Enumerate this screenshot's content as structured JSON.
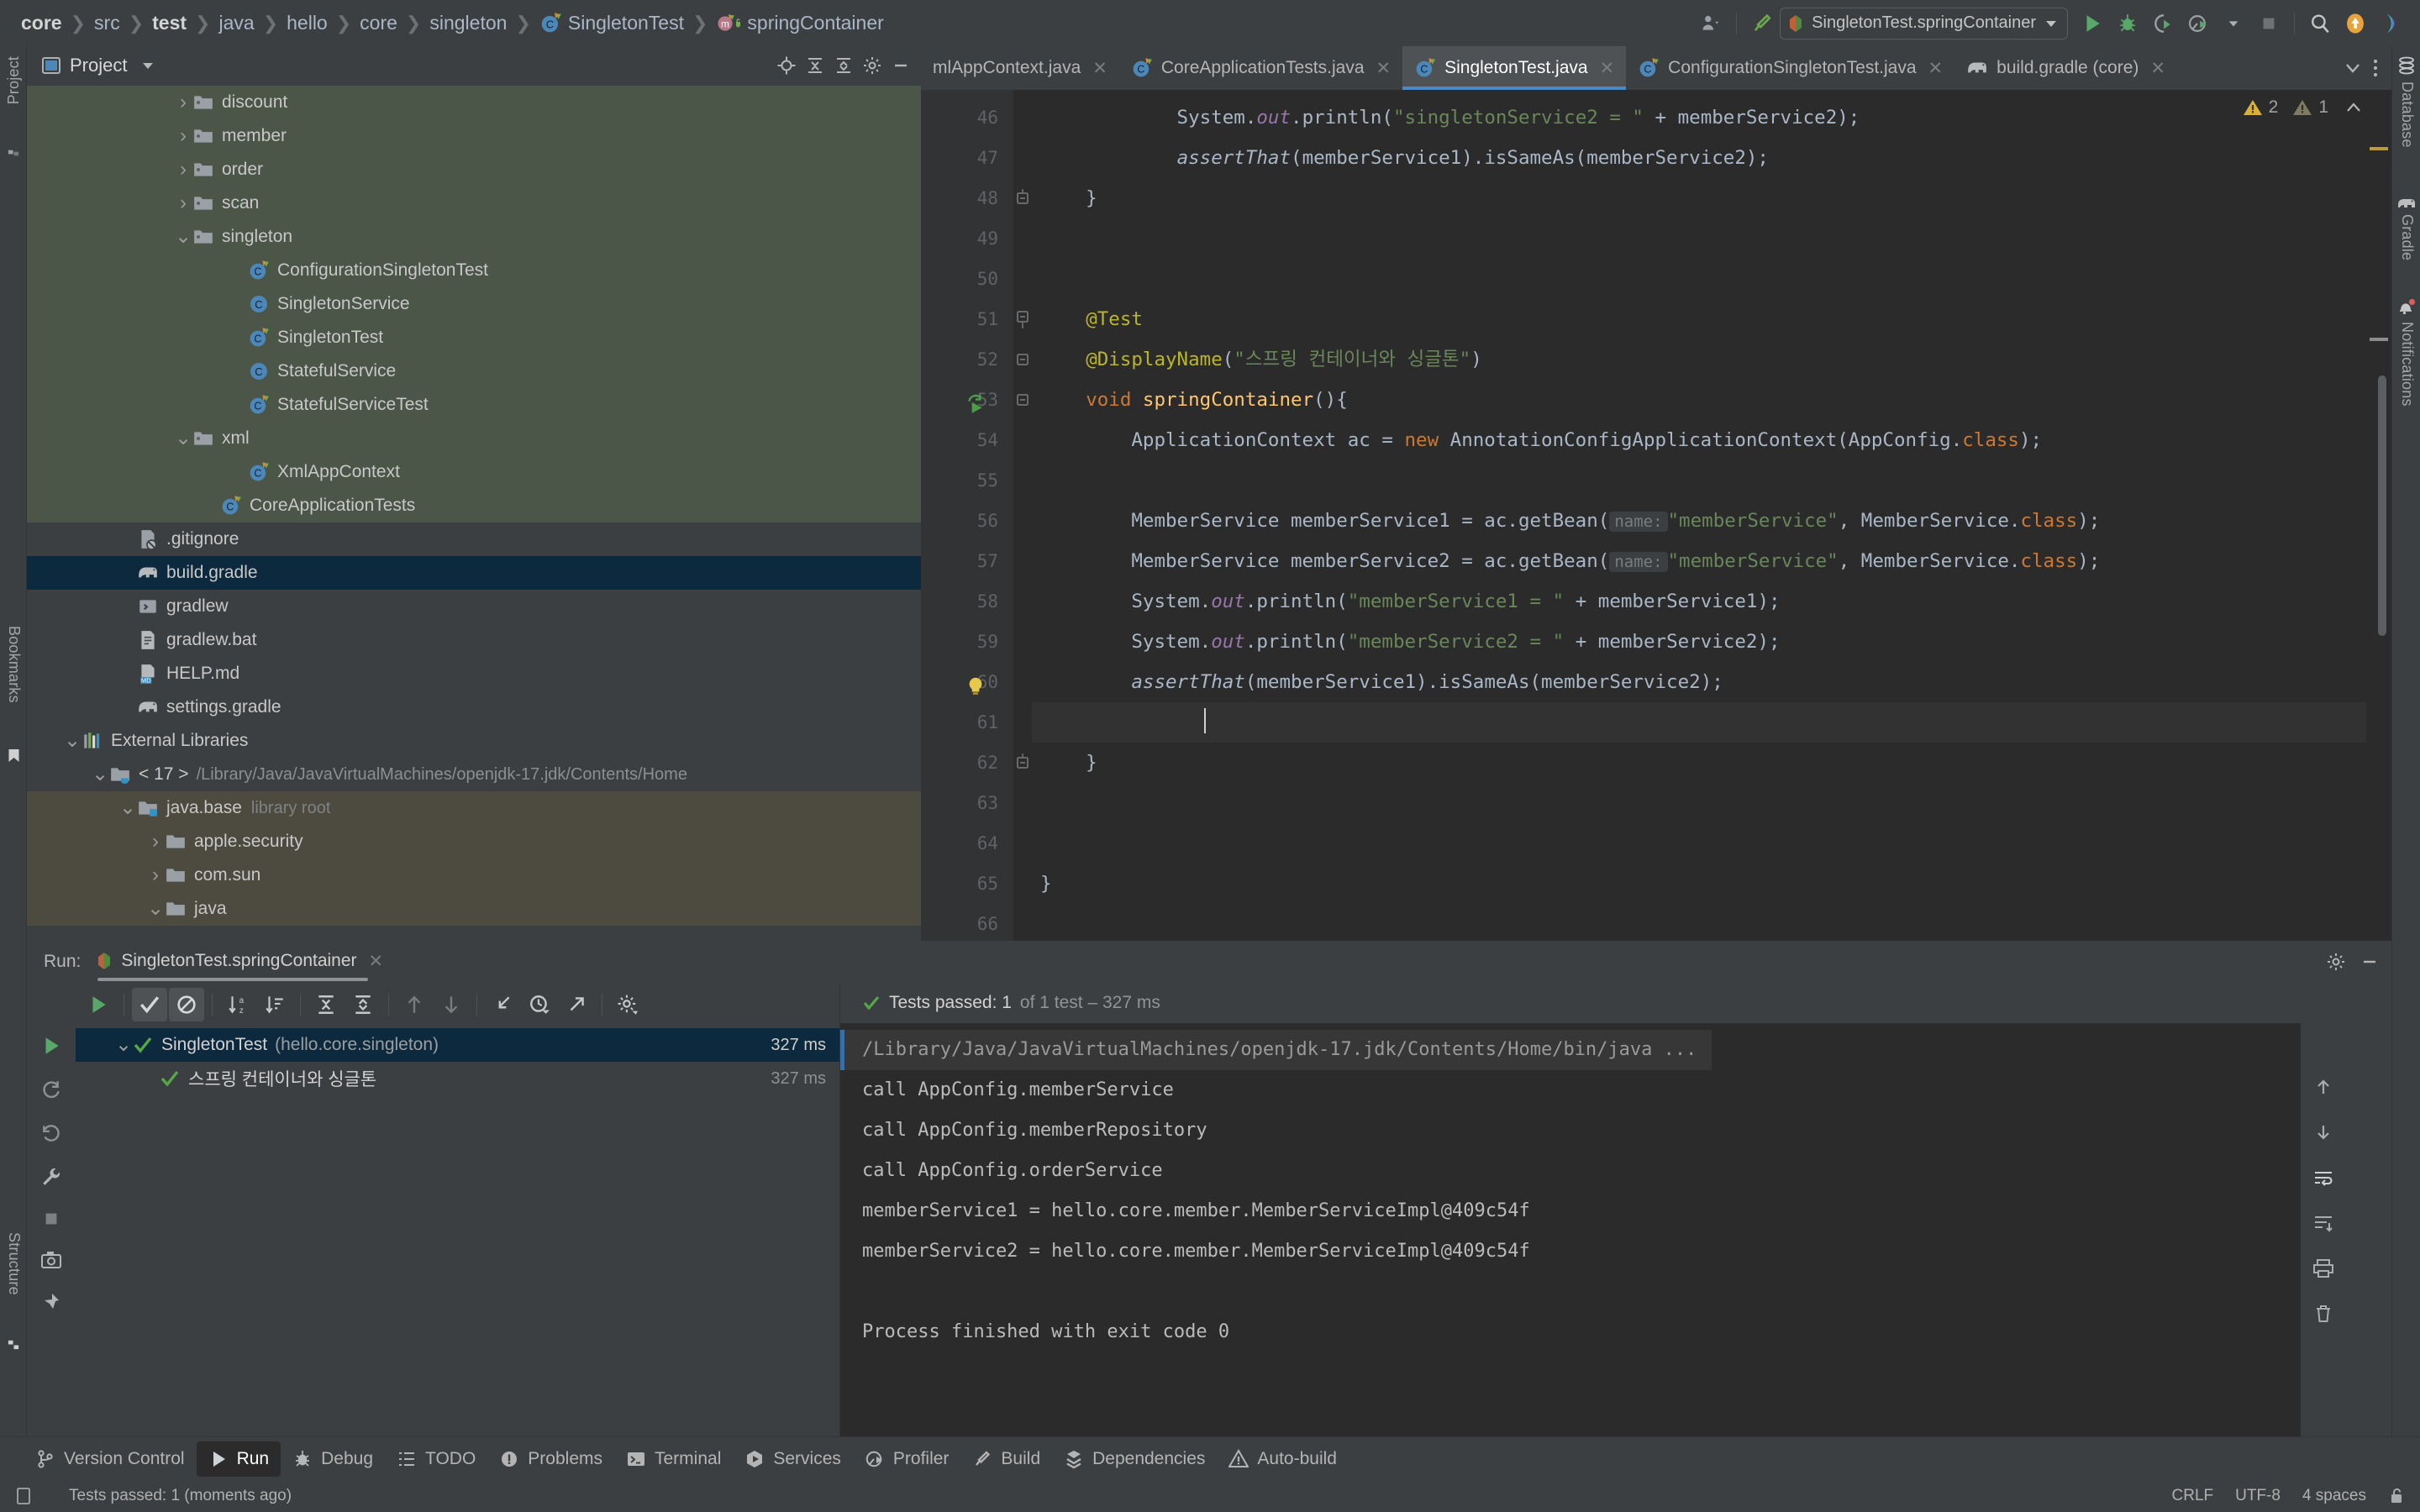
{
  "app": {
    "title": "IntelliJ IDEA - SingletonTest.java"
  },
  "breadcrumb": {
    "items": [
      {
        "label": "core",
        "bold": true,
        "icon": "none"
      },
      {
        "label": "src",
        "bold": false,
        "icon": "none"
      },
      {
        "label": "test",
        "bold": true,
        "icon": "none"
      },
      {
        "label": "java",
        "bold": false,
        "icon": "none"
      },
      {
        "label": "hello",
        "bold": false,
        "icon": "none"
      },
      {
        "label": "core",
        "bold": false,
        "icon": "none"
      },
      {
        "label": "singleton",
        "bold": false,
        "icon": "none"
      },
      {
        "label": "SingletonTest",
        "bold": false,
        "icon": "java-test-class-icon"
      },
      {
        "label": "springContainer",
        "bold": false,
        "icon": "method-icon"
      }
    ]
  },
  "toolbar": {
    "account_icon": "account-icon",
    "build_icon": "build-hammer-icon",
    "run_config": "SingletonTest.springContainer",
    "run_icon": "run-icon",
    "debug_icon": "debug-icon",
    "run_coverage_icon": "run-with-coverage-icon",
    "profiler_icon": "profiler-icon",
    "stop_icon": "stop-icon",
    "search_icon": "search-everywhere-icon",
    "updates_icon": "update-available-icon",
    "ai_icon": "ai-assistant-icon"
  },
  "left_strip": {
    "project_label": "Project",
    "bookmarks_label": "Bookmarks",
    "structure_label": "Structure"
  },
  "right_strip": {
    "items": [
      {
        "label": "Database",
        "icon": "database-icon"
      },
      {
        "label": "Gradle",
        "icon": "gradle-elephant-icon"
      },
      {
        "label": "Notifications",
        "icon": "notifications-bell-icon",
        "badge": true
      }
    ]
  },
  "project_panel": {
    "title": "Project",
    "view_icon": "project-view-icon",
    "chevron": "chevron-down-icon",
    "actions": [
      {
        "icon": "locate-icon"
      },
      {
        "icon": "expand-all-icon"
      },
      {
        "icon": "collapse-all-icon"
      },
      {
        "icon": "settings-gear-icon"
      },
      {
        "icon": "hide-icon"
      }
    ],
    "tree": [
      {
        "label": "discount",
        "icon": "folder-icon",
        "indent": 5,
        "arrow": "collapsed",
        "bg": "green"
      },
      {
        "label": "member",
        "icon": "folder-icon",
        "indent": 5,
        "arrow": "collapsed",
        "bg": "green"
      },
      {
        "label": "order",
        "icon": "folder-icon",
        "indent": 5,
        "arrow": "collapsed",
        "bg": "green"
      },
      {
        "label": "scan",
        "icon": "folder-icon",
        "indent": 5,
        "arrow": "collapsed",
        "bg": "green"
      },
      {
        "label": "singleton",
        "icon": "folder-icon",
        "indent": 5,
        "arrow": "expanded",
        "bg": "green"
      },
      {
        "label": "ConfigurationSingletonTest",
        "icon": "java-test-class-icon",
        "indent": 7,
        "arrow": "none",
        "bg": "green"
      },
      {
        "label": "SingletonService",
        "icon": "java-class-icon",
        "indent": 7,
        "arrow": "none",
        "bg": "green"
      },
      {
        "label": "SingletonTest",
        "icon": "java-test-class-icon",
        "indent": 7,
        "arrow": "none",
        "bg": "green"
      },
      {
        "label": "StatefulService",
        "icon": "java-class-icon",
        "indent": 7,
        "arrow": "none",
        "bg": "green"
      },
      {
        "label": "StatefulServiceTest",
        "icon": "java-test-class-icon",
        "indent": 7,
        "arrow": "none",
        "bg": "green"
      },
      {
        "label": "xml",
        "icon": "folder-icon",
        "indent": 5,
        "arrow": "expanded",
        "bg": "green"
      },
      {
        "label": "XmlAppContext",
        "icon": "java-test-class-icon",
        "indent": 7,
        "arrow": "none",
        "bg": "green"
      },
      {
        "label": "CoreApplicationTests",
        "icon": "java-test-class-icon",
        "indent": 6,
        "arrow": "none",
        "bg": "green"
      },
      {
        "label": ".gitignore",
        "icon": "gitignore-file-icon",
        "indent": 3,
        "arrow": "none",
        "bg": "none"
      },
      {
        "label": "build.gradle",
        "icon": "gradle-elephant-icon",
        "indent": 3,
        "arrow": "none",
        "bg": "selected"
      },
      {
        "label": "gradlew",
        "icon": "shell-script-icon",
        "indent": 3,
        "arrow": "none",
        "bg": "none"
      },
      {
        "label": "gradlew.bat",
        "icon": "text-file-icon",
        "indent": 3,
        "arrow": "none",
        "bg": "none"
      },
      {
        "label": "HELP.md",
        "icon": "markdown-file-icon",
        "indent": 3,
        "arrow": "none",
        "bg": "none"
      },
      {
        "label": "settings.gradle",
        "icon": "gradle-elephant-icon",
        "indent": 3,
        "arrow": "none",
        "bg": "none"
      },
      {
        "label": "External Libraries",
        "icon": "libraries-icon",
        "indent": 1,
        "arrow": "expanded",
        "bg": "none"
      },
      {
        "label": "< 17 >",
        "sub": "/Library/Java/JavaVirtualMachines/openjdk-17.jdk/Contents/Home",
        "subtype": "path",
        "icon": "jdk-folder-icon",
        "indent": 2,
        "arrow": "expanded",
        "bg": "none"
      },
      {
        "label": "java.base",
        "sub": "library root",
        "subtype": "hint",
        "icon": "module-folder-icon",
        "indent": 3,
        "arrow": "expanded",
        "bg": "brown"
      },
      {
        "label": "apple.security",
        "icon": "package-folder-icon",
        "indent": 4,
        "arrow": "collapsed",
        "bg": "brown"
      },
      {
        "label": "com.sun",
        "icon": "package-folder-icon",
        "indent": 4,
        "arrow": "collapsed",
        "bg": "brown"
      },
      {
        "label": "java",
        "icon": "package-folder-icon",
        "indent": 4,
        "arrow": "expanded",
        "bg": "brown"
      }
    ]
  },
  "editor": {
    "tabs": [
      {
        "label": "mlAppContext.java",
        "icon": "java-test-class-icon",
        "active": false,
        "truncated": true
      },
      {
        "label": "CoreApplicationTests.java",
        "icon": "java-test-class-icon",
        "active": false
      },
      {
        "label": "SingletonTest.java",
        "icon": "java-test-class-icon",
        "active": true
      },
      {
        "label": "ConfigurationSingletonTest.java",
        "icon": "java-test-class-icon",
        "active": false
      },
      {
        "label": "build.gradle (core)",
        "icon": "gradle-elephant-icon",
        "active": false
      }
    ],
    "tab_actions": [
      {
        "icon": "chevron-down-icon"
      },
      {
        "icon": "more-options-icon"
      }
    ],
    "inspections": {
      "warning_icon": "warning-triangle-icon",
      "warning_count": "2",
      "weak_warning_icon": "weak-warning-triangle-icon",
      "weak_warning_count": "1",
      "collapse_icon": "chevron-up-icon"
    },
    "first_line_number": 46,
    "lines": [
      {
        "n": 46,
        "fold": "none",
        "gutter_icon": "none",
        "tokens": [
          {
            "t": "            System.",
            "c": "plain"
          },
          {
            "t": "out",
            "c": "fld"
          },
          {
            "t": ".println(",
            "c": "plain"
          },
          {
            "t": "\"singletonService2 = \"",
            "c": "str"
          },
          {
            "t": " + memberService2);",
            "c": "plain"
          }
        ]
      },
      {
        "n": 47,
        "fold": "none",
        "gutter_icon": "none",
        "tokens": [
          {
            "t": "            ",
            "c": "plain"
          },
          {
            "t": "assertThat",
            "c": "stat"
          },
          {
            "t": "(memberService1).isSameAs(memberService2);",
            "c": "plain"
          }
        ]
      },
      {
        "n": 48,
        "fold": "end",
        "gutter_icon": "none",
        "tokens": [
          {
            "t": "    }",
            "c": "plain"
          }
        ]
      },
      {
        "n": 49,
        "fold": "none",
        "gutter_icon": "none",
        "tokens": []
      },
      {
        "n": 50,
        "fold": "none",
        "gutter_icon": "none",
        "tokens": []
      },
      {
        "n": 51,
        "fold": "start",
        "gutter_icon": "none",
        "tokens": [
          {
            "t": "    ",
            "c": "plain"
          },
          {
            "t": "@Test",
            "c": "ann"
          }
        ]
      },
      {
        "n": 52,
        "fold": "mid",
        "gutter_icon": "none",
        "tokens": [
          {
            "t": "    ",
            "c": "plain"
          },
          {
            "t": "@DisplayName",
            "c": "ann"
          },
          {
            "t": "(",
            "c": "plain"
          },
          {
            "t": "\"스프링 컨테이너와 싱글톤\"",
            "c": "str"
          },
          {
            "t": ")",
            "c": "plain"
          }
        ]
      },
      {
        "n": 53,
        "fold": "mid",
        "gutter_icon": "run-test-icon",
        "tokens": [
          {
            "t": "    ",
            "c": "plain"
          },
          {
            "t": "void ",
            "c": "kw"
          },
          {
            "t": "springContainer",
            "c": "mth"
          },
          {
            "t": "(){",
            "c": "plain"
          }
        ]
      },
      {
        "n": 54,
        "fold": "none",
        "gutter_icon": "none",
        "tokens": [
          {
            "t": "        ApplicationContext ac = ",
            "c": "plain"
          },
          {
            "t": "new",
            "c": "kw"
          },
          {
            "t": " AnnotationConfigApplicationContext(AppConfig.",
            "c": "plain"
          },
          {
            "t": "class",
            "c": "kw"
          },
          {
            "t": ");",
            "c": "plain"
          }
        ]
      },
      {
        "n": 55,
        "fold": "none",
        "gutter_icon": "none",
        "tokens": []
      },
      {
        "n": 56,
        "fold": "none",
        "gutter_icon": "none",
        "tokens": [
          {
            "t": "        MemberService memberService1 = ac.getBean(",
            "c": "plain"
          },
          {
            "t": "name:",
            "c": "hint"
          },
          {
            "t": "\"memberService\"",
            "c": "str"
          },
          {
            "t": ", MemberService.",
            "c": "plain"
          },
          {
            "t": "class",
            "c": "kw"
          },
          {
            "t": ");",
            "c": "plain"
          }
        ]
      },
      {
        "n": 57,
        "fold": "none",
        "gutter_icon": "none",
        "tokens": [
          {
            "t": "        MemberService memberService2 = ac.getBean(",
            "c": "plain"
          },
          {
            "t": "name:",
            "c": "hint"
          },
          {
            "t": "\"memberService\"",
            "c": "str"
          },
          {
            "t": ", MemberService.",
            "c": "plain"
          },
          {
            "t": "class",
            "c": "kw"
          },
          {
            "t": ");",
            "c": "plain"
          }
        ]
      },
      {
        "n": 58,
        "fold": "none",
        "gutter_icon": "none",
        "tokens": [
          {
            "t": "        System.",
            "c": "plain"
          },
          {
            "t": "out",
            "c": "fld"
          },
          {
            "t": ".println(",
            "c": "plain"
          },
          {
            "t": "\"memberService1 = \"",
            "c": "str"
          },
          {
            "t": " + memberService1);",
            "c": "plain"
          }
        ]
      },
      {
        "n": 59,
        "fold": "none",
        "gutter_icon": "none",
        "tokens": [
          {
            "t": "        System.",
            "c": "plain"
          },
          {
            "t": "out",
            "c": "fld"
          },
          {
            "t": ".println(",
            "c": "plain"
          },
          {
            "t": "\"memberService2 = \"",
            "c": "str"
          },
          {
            "t": " + memberService2);",
            "c": "plain"
          }
        ]
      },
      {
        "n": 60,
        "fold": "none",
        "gutter_icon": "intention-bulb-icon",
        "tokens": [
          {
            "t": "        ",
            "c": "plain"
          },
          {
            "t": "assertThat",
            "c": "stat"
          },
          {
            "t": "(memberService1).isSameAs(memberService2);",
            "c": "plain"
          }
        ]
      },
      {
        "n": 61,
        "fold": "none",
        "gutter_icon": "none",
        "caret": true,
        "tokens": []
      },
      {
        "n": 62,
        "fold": "end",
        "gutter_icon": "none",
        "tokens": [
          {
            "t": "    }",
            "c": "plain"
          }
        ]
      },
      {
        "n": 63,
        "fold": "none",
        "gutter_icon": "none",
        "tokens": []
      },
      {
        "n": 64,
        "fold": "none",
        "gutter_icon": "none",
        "tokens": []
      },
      {
        "n": 65,
        "fold": "none",
        "gutter_icon": "none",
        "tokens": [
          {
            "t": "}",
            "c": "plain"
          }
        ]
      },
      {
        "n": 66,
        "fold": "none",
        "gutter_icon": "none",
        "tokens": []
      }
    ]
  },
  "run_panel": {
    "run_label": "Run:",
    "tab_label": "SingletonTest.springContainer",
    "tab_icon": "test-config-icon",
    "tab_close_icon": "close-icon",
    "settings_icon": "settings-gear-icon",
    "hide_icon": "hide-icon",
    "toolbar": [
      {
        "icon": "rerun-icon",
        "name": "rerun-button",
        "on": false
      },
      {
        "icon": "show-passed-icon",
        "name": "show-passed-toggle",
        "on": true
      },
      {
        "icon": "show-ignored-icon",
        "name": "show-ignored-toggle",
        "on": true
      },
      {
        "icon": "sort-alphabetically-icon",
        "name": "sort-alphabetically-button",
        "on": false
      },
      {
        "icon": "sort-by-duration-icon",
        "name": "sort-by-duration-button",
        "on": false
      },
      {
        "icon": "expand-all-icon",
        "name": "expand-all-button",
        "on": false
      },
      {
        "icon": "collapse-all-icon",
        "name": "collapse-all-button",
        "on": false
      },
      {
        "icon": "previous-failed-icon",
        "name": "prev-failed-button",
        "on": false
      },
      {
        "icon": "next-failed-icon",
        "name": "next-failed-button",
        "on": false
      },
      {
        "icon": "import-tests-icon",
        "name": "import-tests-button",
        "on": false
      },
      {
        "icon": "test-history-icon",
        "name": "test-history-button",
        "on": false
      },
      {
        "icon": "export-tests-icon",
        "name": "export-tests-button",
        "on": false
      },
      {
        "icon": "settings-gear-icon",
        "name": "test-settings-button",
        "on": false
      }
    ],
    "side_tools": [
      {
        "icon": "rerun-tests-icon"
      },
      {
        "icon": "rerun-failed-icon"
      },
      {
        "icon": "toggle-auto-test-icon"
      },
      {
        "icon": "wrench-icon"
      },
      {
        "icon": "stop-icon"
      },
      {
        "icon": "camera-icon"
      },
      {
        "icon": "pin-icon"
      }
    ],
    "results": [
      {
        "label": "SingletonTest",
        "sub": "(hello.core.singleton)",
        "time": "327 ms",
        "status_icon": "test-passed-icon",
        "arrow": "expanded",
        "selected": true,
        "indent": 1
      },
      {
        "label": "스프링 컨테이너와 싱글톤",
        "sub": "",
        "time": "327 ms",
        "status_icon": "test-passed-icon",
        "arrow": "none",
        "selected": false,
        "indent": 2
      }
    ],
    "status": {
      "icon": "test-passed-icon",
      "bold_text": "Tests passed: 1",
      "dim_text": " of 1 test – 327 ms"
    },
    "console": [
      {
        "text": "/Library/Java/JavaVirtualMachines/openjdk-17.jdk/Contents/Home/bin/java ...",
        "type": "cmd"
      },
      {
        "text": "call AppConfig.memberService",
        "type": "out"
      },
      {
        "text": "call AppConfig.memberRepository",
        "type": "out"
      },
      {
        "text": "call AppConfig.orderService",
        "type": "out"
      },
      {
        "text": "memberService1 = hello.core.member.MemberServiceImpl@409c54f",
        "type": "out"
      },
      {
        "text": "memberService2 = hello.core.member.MemberServiceImpl@409c54f",
        "type": "out"
      },
      {
        "text": "",
        "type": "out"
      },
      {
        "text": "Process finished with exit code 0",
        "type": "out"
      }
    ],
    "console_side_buttons": [
      {
        "icon": "scroll-to-top-icon"
      },
      {
        "icon": "scroll-to-bottom-icon"
      },
      {
        "icon": "soft-wrap-icon"
      },
      {
        "icon": "use-console-filter-icon"
      },
      {
        "icon": "print-icon"
      },
      {
        "icon": "clear-all-icon"
      }
    ]
  },
  "tool_window_bar": {
    "items": [
      {
        "label": "Version Control",
        "icon": "version-control-icon",
        "active": false
      },
      {
        "label": "Run",
        "icon": "run-icon",
        "active": true
      },
      {
        "label": "Debug",
        "icon": "debug-icon",
        "active": false
      },
      {
        "label": "TODO",
        "icon": "todo-icon",
        "active": false
      },
      {
        "label": "Problems",
        "icon": "problems-icon",
        "active": false
      },
      {
        "label": "Terminal",
        "icon": "terminal-icon",
        "active": false
      },
      {
        "label": "Services",
        "icon": "services-icon",
        "active": false
      },
      {
        "label": "Profiler",
        "icon": "profiler-icon",
        "active": false
      },
      {
        "label": "Build",
        "icon": "build-hammer-icon",
        "active": false
      },
      {
        "label": "Dependencies",
        "icon": "dependencies-icon",
        "active": false
      },
      {
        "label": "Auto-build",
        "icon": "auto-build-icon",
        "active": false
      }
    ]
  },
  "status_bar": {
    "message_icon": "event-log-icon",
    "message": "Tests passed: 1 (moments ago)",
    "line_separator": "CRLF",
    "encoding": "UTF-8",
    "indent": "4 spaces",
    "lock_icon": "unlocked-icon"
  }
}
